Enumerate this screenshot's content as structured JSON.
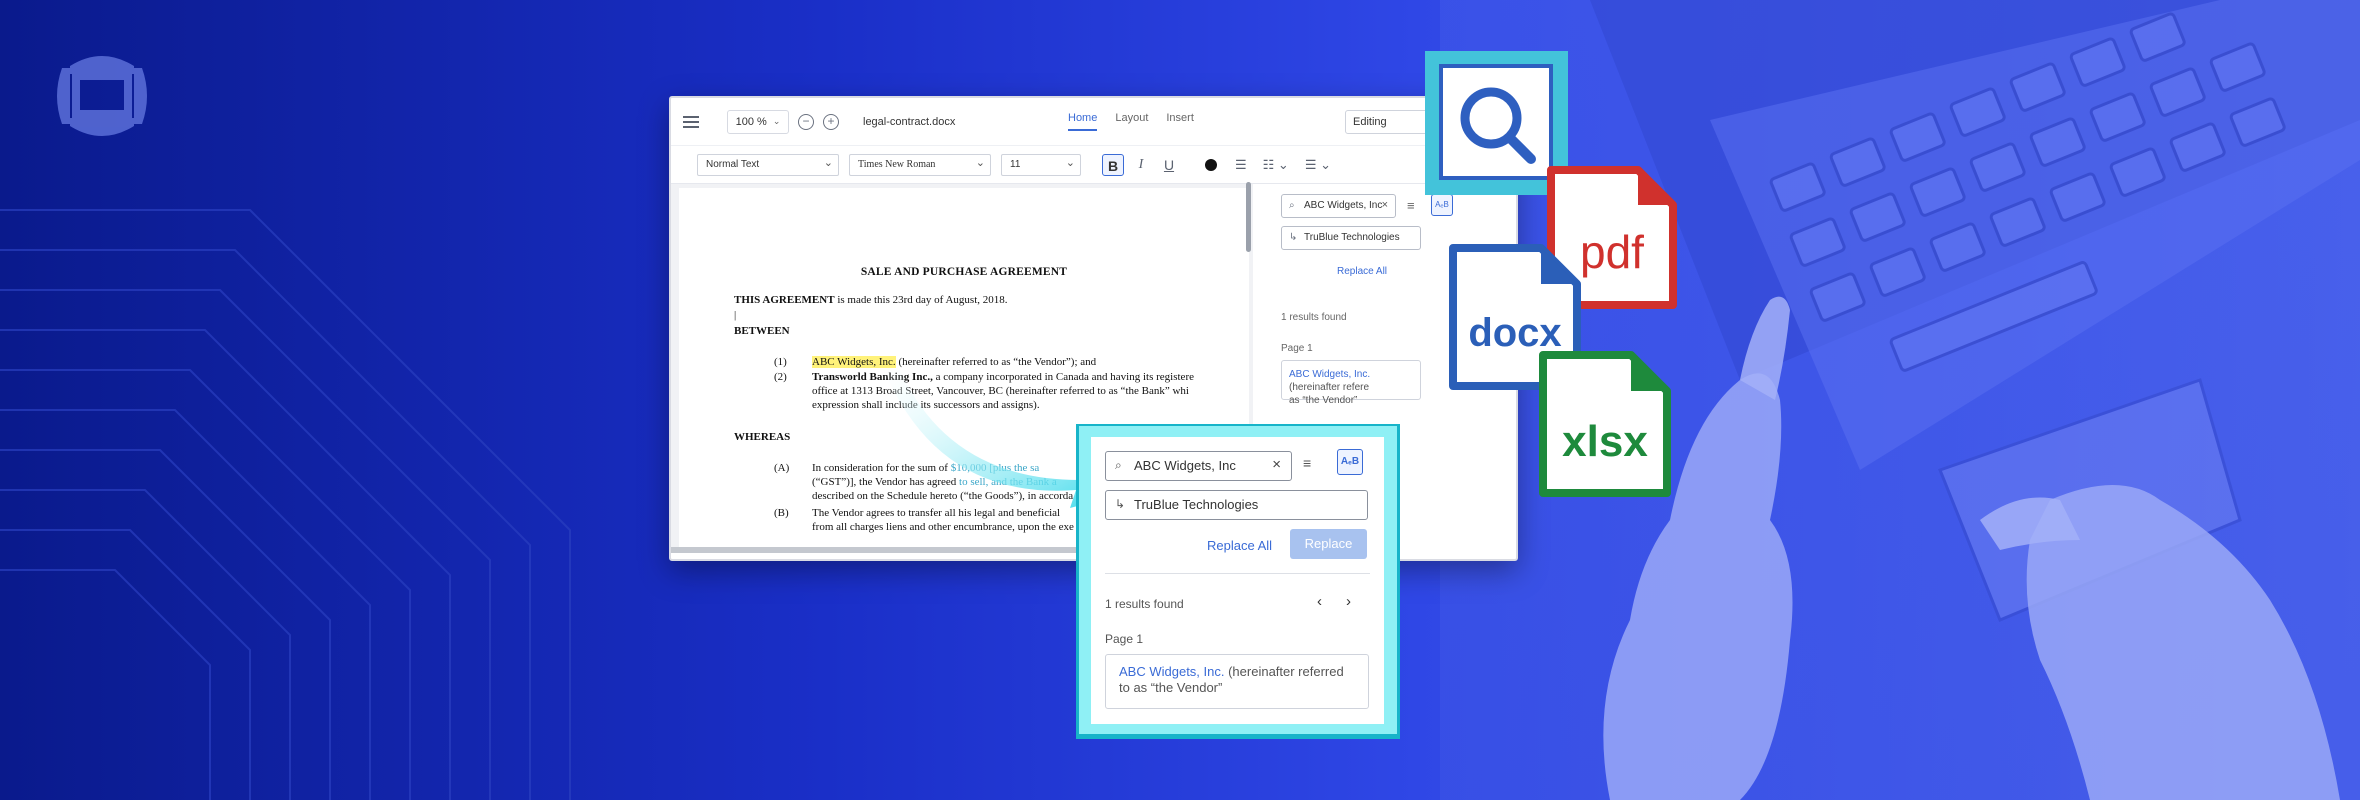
{
  "editor": {
    "zoom": "100 %",
    "filename": "legal-contract.docx",
    "tabs": [
      "Home",
      "Layout",
      "Insert"
    ],
    "mode": "Editing",
    "toolbar": {
      "style": "Normal Text",
      "font": "Times New Roman",
      "size": "11",
      "bold": "B",
      "italic": "I",
      "underline": "U"
    }
  },
  "document": {
    "title": "SALE AND PURCHASE AGREEMENT",
    "agreement_bold": "THIS AGREEMENT",
    "agreement_rest": " is made this 23rd day of August, 2018.",
    "between": "BETWEEN",
    "item1_num": "(1)",
    "item1_highlight": "ABC Widgets, Inc.",
    "item1_rest": " (hereinafter referred to as “the Vendor”); and",
    "item2_num": "(2)",
    "item2_bold": "Transworld Banking Inc.,",
    "item2_rest": " a company incorporated in Canada and having its registere",
    "item2_line2": "office at 1313 Broad Street, Vancouver, BC (hereinafter referred to as “the Bank” whi",
    "item2_line3": "expression shall include its successors and assigns).",
    "whereas": "WHEREAS",
    "itemA_num": "(A)",
    "itemA_line1_a": "In consideration for the sum of ",
    "itemA_line1_b": "$10,000 [plus the sa",
    "itemA_line2_a": "(“GST”)], the Vendor has agreed",
    "itemA_line2_b": " to sell, and the Bank a",
    "itemA_line3": "described on the Schedule hereto (“the Goods”), in accorda",
    "itemB_num": "(B)",
    "itemB_line1": "The Vendor agrees to transfer all his legal and beneficial",
    "itemB_line2": "from all charges liens and other encumbrance, upon the exe"
  },
  "find_panel": {
    "search_value": "ABC Widgets, Inc",
    "replace_value": "TruBlue Technologies",
    "replace_all": "Replace All",
    "replace": "Replace",
    "results_count": "1 results found",
    "page_label": "Page 1",
    "result_match": "ABC Widgets, Inc.",
    "result_rest": " (hereinafter referred to as “the Vendor”",
    "result_rest_small": " (hereinafter refere",
    "result_line2_small": "as “the Vendor”",
    "case_icon_label": "AₑB"
  },
  "file_icons": [
    "pdf",
    "docx",
    "xlsx"
  ],
  "colors": {
    "accent": "#3a6bd6",
    "pdf": "#d0312d",
    "docx": "#2b5fb8",
    "xlsx": "#1e8a3c",
    "callout_frame": "#17b4c9",
    "highlight": "#fff27a"
  }
}
